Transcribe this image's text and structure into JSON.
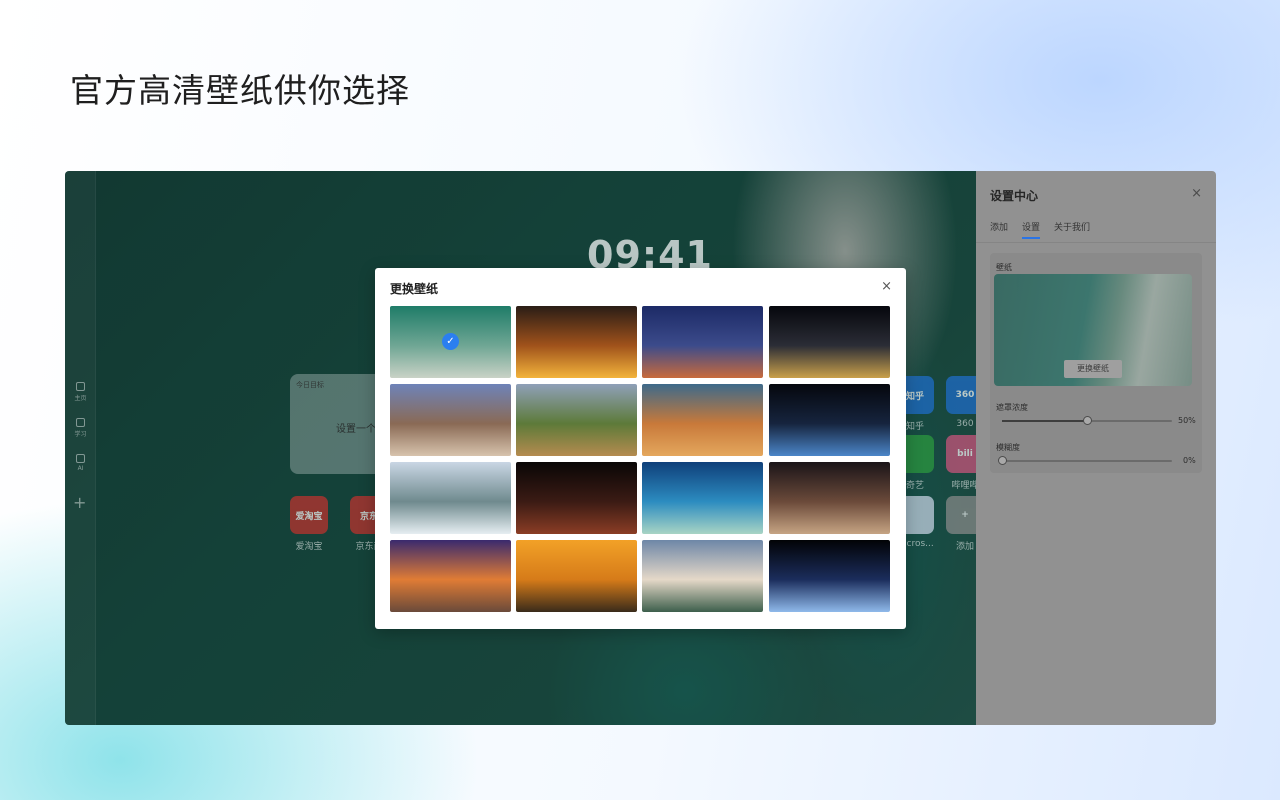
{
  "headline": "官方高清壁纸供你选择",
  "desktop": {
    "clock": "09:41",
    "rail": [
      {
        "label": "主页"
      },
      {
        "label": "学习"
      },
      {
        "label": "AI"
      }
    ],
    "rail_add": "+",
    "goal_card": {
      "title": "今日目标",
      "text": "设置一个"
    },
    "apps": [
      {
        "label": "爱淘宝",
        "tile": "爱淘宝",
        "color": "#c4322d"
      },
      {
        "label": "京东商",
        "tile": "京东",
        "color": "#c4322d"
      },
      {
        "label": "知乎",
        "tile": "知乎",
        "color": "#1f6fd0"
      },
      {
        "label": "360",
        "tile": "360",
        "color": "#1f6fd0"
      },
      {
        "label": "奇艺",
        "tile": "",
        "color": "#2d9d3e"
      },
      {
        "label": "哔哩哔",
        "tile": "bili",
        "color": "#d2557f"
      },
      {
        "label": "Micros...",
        "tile": "",
        "color": "#cfd8ea"
      },
      {
        "label": "添加",
        "tile": "+",
        "color": "#8c8c8c"
      }
    ]
  },
  "settings": {
    "title": "设置中心",
    "close": "×",
    "tabs": [
      "添加",
      "设置",
      "关于我们"
    ],
    "active_tab": "设置",
    "wallpaper_label": "壁纸",
    "change_button": "更换壁纸",
    "mask_label": "遮罩浓度",
    "mask_value": "50%",
    "mask_level": 0.5,
    "blur_label": "模糊度",
    "blur_value": "0%",
    "blur_level": 0.0
  },
  "modal": {
    "title": "更换壁纸",
    "close": "×",
    "selected_index": 0,
    "wallpapers": [
      {
        "name": "aerial-beach",
        "c1": "#1f7c68",
        "c2": "#6fa694",
        "c3": "#c9d2c6"
      },
      {
        "name": "city-sunset-street",
        "c1": "#2a1d16",
        "c2": "#a0521b",
        "c3": "#f3b43b"
      },
      {
        "name": "mountain-lake-night",
        "c1": "#1c2a66",
        "c2": "#3c4b8b",
        "c3": "#c86a3c"
      },
      {
        "name": "earth-night-lights",
        "c1": "#06070d",
        "c2": "#2b2d36",
        "c3": "#c9a04a"
      },
      {
        "name": "volcano-valley",
        "c1": "#6e83b8",
        "c2": "#8a6a55",
        "c3": "#d7c3ad"
      },
      {
        "name": "green-mountain-peak",
        "c1": "#8fa0b8",
        "c2": "#5d7a39",
        "c3": "#b58b4f"
      },
      {
        "name": "desert-dunes",
        "c1": "#3e6a8a",
        "c2": "#c8793a",
        "c3": "#e4a75d"
      },
      {
        "name": "space-earth-sun",
        "c1": "#05070d",
        "c2": "#16243e",
        "c3": "#4b86c8"
      },
      {
        "name": "misty-lake",
        "c1": "#c9d6e4",
        "c2": "#6f8a8e",
        "c3": "#e6eef2"
      },
      {
        "name": "mars-horizon",
        "c1": "#090606",
        "c2": "#3b1b14",
        "c3": "#8b3d25"
      },
      {
        "name": "coral-island",
        "c1": "#0f3f7a",
        "c2": "#2c8cc0",
        "c3": "#a8d4c4"
      },
      {
        "name": "nebula",
        "c1": "#1a1418",
        "c2": "#6b4a3a",
        "c3": "#c6a483"
      },
      {
        "name": "sunset-hills",
        "c1": "#3a2a6e",
        "c2": "#e07c35",
        "c3": "#6a4a3a"
      },
      {
        "name": "savanna-elephants",
        "c1": "#f2a127",
        "c2": "#d67b19",
        "c3": "#3a2b1a"
      },
      {
        "name": "snowy-mountain-lake",
        "c1": "#6e87a7",
        "c2": "#e5d8c8",
        "c3": "#3d5f4c"
      },
      {
        "name": "earth-from-space",
        "c1": "#020306",
        "c2": "#1b2d5c",
        "c3": "#8fb9ea"
      }
    ]
  }
}
